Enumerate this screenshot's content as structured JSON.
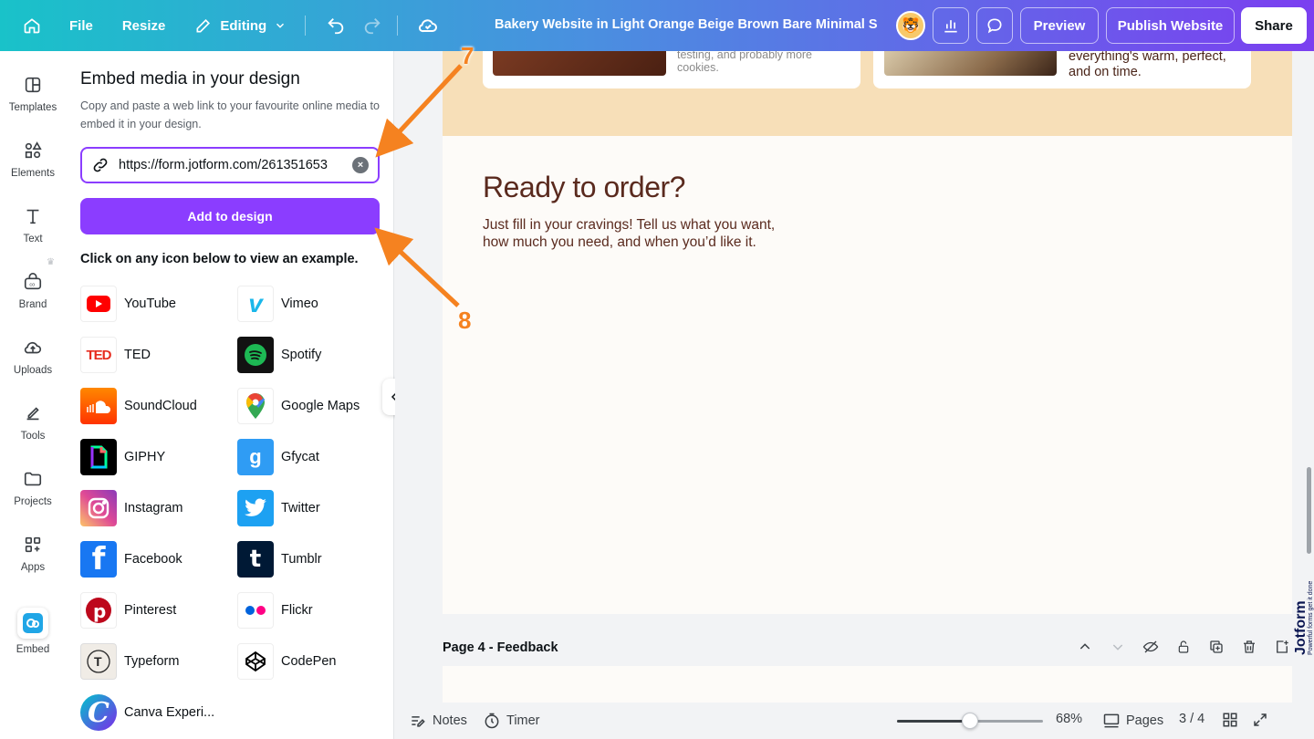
{
  "topbar": {
    "file": "File",
    "resize": "Resize",
    "editing": "Editing",
    "title": "Bakery Website in Light Orange Beige Brown Bare Minimal S...",
    "preview": "Preview",
    "publish": "Publish Website",
    "share": "Share"
  },
  "rail": [
    {
      "label": "Templates",
      "icon": "templates-icon"
    },
    {
      "label": "Elements",
      "icon": "elements-icon"
    },
    {
      "label": "Text",
      "icon": "text-icon"
    },
    {
      "label": "Brand",
      "icon": "brand-icon"
    },
    {
      "label": "Uploads",
      "icon": "uploads-icon"
    },
    {
      "label": "Tools",
      "icon": "tools-icon"
    },
    {
      "label": "Projects",
      "icon": "projects-icon"
    },
    {
      "label": "Apps",
      "icon": "apps-icon"
    },
    {
      "label": "Embed",
      "icon": "embed-icon"
    }
  ],
  "panel": {
    "title": "Embed media in your design",
    "description": "Copy and paste a web link to your favourite online media to embed it in your design.",
    "url_value": "https://form.jotform.com/261351653",
    "add_button": "Add to design",
    "hint": "Click on any icon below to view an example.",
    "services": [
      {
        "name": "YouTube",
        "color": "#ff0000"
      },
      {
        "name": "Vimeo",
        "color": "#1ab7ea"
      },
      {
        "name": "TED",
        "color": "#e62b1e"
      },
      {
        "name": "Spotify",
        "color": "#1db954"
      },
      {
        "name": "SoundCloud",
        "color": "#ff5500"
      },
      {
        "name": "Google Maps",
        "color": "#34a853"
      },
      {
        "name": "GIPHY",
        "color": "#000000"
      },
      {
        "name": "Gfycat",
        "color": "#2f9cf4"
      },
      {
        "name": "Instagram",
        "color": "#c13584"
      },
      {
        "name": "Twitter",
        "color": "#1da1f2"
      },
      {
        "name": "Facebook",
        "color": "#1877f2"
      },
      {
        "name": "Tumblr",
        "color": "#001935"
      },
      {
        "name": "Pinterest",
        "color": "#bd081c"
      },
      {
        "name": "Flickr",
        "color": "#ff0084"
      },
      {
        "name": "Typeform",
        "color": "#262627"
      },
      {
        "name": "CodePen",
        "color": "#000000"
      },
      {
        "name": "Canva Experi...",
        "color": "#7d2ae8"
      }
    ]
  },
  "canvas": {
    "card1_text": "testing, and probably more cookies.",
    "card2_text": "everything's warm, perfect, and on time.",
    "ready_title": "Ready to order?",
    "ready_body": "Just fill in your cravings! Tell us what you want, how much you need, and when you’d like it.",
    "page4_label": "Page 4 - Feedback"
  },
  "bottombar": {
    "notes": "Notes",
    "timer": "Timer",
    "zoom": "68%",
    "zoom_fraction": 0.5,
    "pages": "Pages",
    "page_count": "3 / 4"
  },
  "annotations": {
    "step7": "7",
    "step8": "8"
  },
  "watermark": {
    "brand": "Jotform",
    "tagline": "Powerful forms get it done"
  },
  "colors": {
    "accent": "#8b3dff",
    "annotation": "#f58220",
    "heading": "#5a2a1e"
  }
}
